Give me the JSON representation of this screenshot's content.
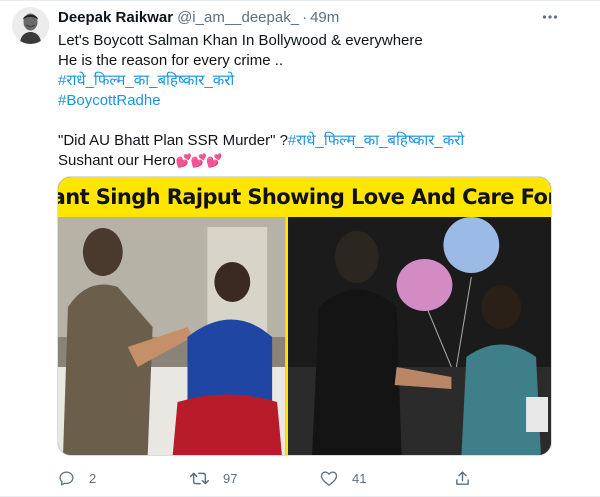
{
  "author": {
    "name": "Deepak Raikwar",
    "handle": "@i_am__deepak_",
    "separator": "·",
    "time": "49m"
  },
  "tweet": {
    "lines": [
      "Let's Boycott Salman Khan In Bollywood & everywhere",
      "He is the reason for every crime ..",
      "#राधे_फिल्म_का_बहिष्कार_करो",
      "#BoycottRadhe",
      "\"Did AU Bhatt Plan SSR Murder\" ?",
      "#राधे_फिल्म_का_बहिष्कार_करो",
      "Sushant our Hero"
    ],
    "hearts": "💕💕💕"
  },
  "media": {
    "banner_text": "Sushant Singh Rajput Showing Love And Care For Kids"
  },
  "actions": {
    "reply_count": "2",
    "retweet_count": "97",
    "like_count": "41"
  },
  "colors": {
    "link": "#1b95e0",
    "secondary_text": "#5b7083",
    "banner_bg": "#ffe600"
  }
}
